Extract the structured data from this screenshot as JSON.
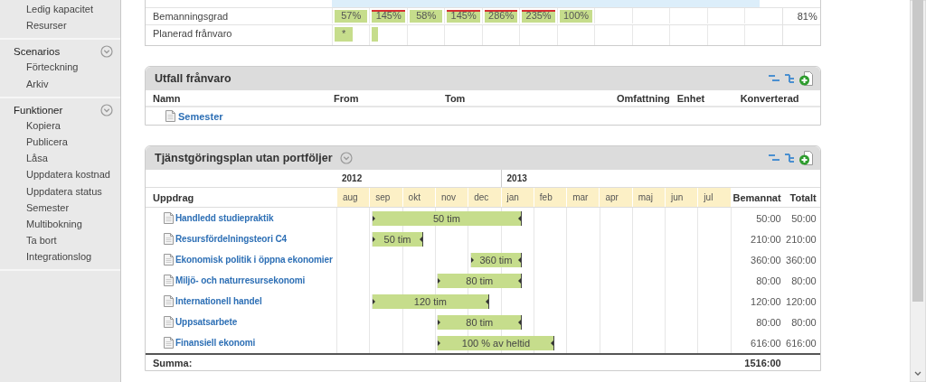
{
  "sidebar": {
    "groups": [
      {
        "items": [
          "Ledig kapacitet",
          "Resurser"
        ]
      },
      {
        "title": "Scenarios",
        "items": [
          "Förteckning",
          "Arkiv"
        ]
      },
      {
        "title": "Funktioner",
        "items": [
          "Kopiera",
          "Publicera",
          "Låsa",
          "Uppdatera kostnad",
          "Uppdatera status",
          "Semester",
          "Multibokning",
          "Ta bort",
          "Integrationslog"
        ]
      }
    ]
  },
  "staffing": {
    "rows": [
      {
        "label": "Bemanningsgrad",
        "kind": "percent",
        "total": "81%",
        "cells": [
          {
            "text": "57%",
            "over": false
          },
          {
            "text": "145%",
            "over": true
          },
          {
            "text": "58%",
            "over": false
          },
          {
            "text": "145%",
            "over": true
          },
          {
            "text": "286%",
            "over": true
          },
          {
            "text": "235%",
            "over": true
          },
          {
            "text": "100%",
            "over": false
          }
        ]
      },
      {
        "label": "Planerad frånvaro",
        "kind": "absence",
        "cells": [
          {
            "text": "*",
            "level": 0.5
          },
          {
            "level": 0.17
          }
        ]
      }
    ]
  },
  "absence": {
    "title": "Utfall frånvaro",
    "columns": [
      "Namn",
      "From",
      "Tom",
      "Omfattning",
      "Enhet",
      "Konverterad"
    ],
    "rows": [
      {
        "name": "Semester"
      }
    ]
  },
  "plan": {
    "title": "Tjänstgöringsplan utan portföljer",
    "years": [
      {
        "label": "2012",
        "months": [
          "aug",
          "sep",
          "okt",
          "nov",
          "dec"
        ]
      },
      {
        "label": "2013",
        "months": [
          "jan",
          "feb",
          "mar",
          "apr",
          "maj",
          "jun",
          "jul"
        ]
      }
    ],
    "first_column": "Uppdrag",
    "sum_columns": [
      "Bemannat",
      "Totalt"
    ],
    "rows": [
      {
        "name": "Handledd studiepraktik",
        "covered": [
          false,
          true,
          true,
          true,
          true,
          true,
          false,
          false,
          false,
          false,
          false,
          false
        ],
        "bar": "50 tim",
        "staffed": "50:00",
        "total": "50:00"
      },
      {
        "name": "Resursfördelningsteori C4",
        "covered": [
          false,
          true,
          true,
          false,
          false,
          false,
          false,
          false,
          false,
          false,
          false,
          false
        ],
        "bar": "50 tim",
        "staffed": "210:00",
        "total": "210:00"
      },
      {
        "name": "Ekonomisk politik i öppna ekonomier",
        "covered": [
          false,
          false,
          false,
          false,
          true,
          true,
          false,
          false,
          false,
          false,
          false,
          false
        ],
        "bar": "360 tim",
        "staffed": "360:00",
        "total": "360:00"
      },
      {
        "name": "Miljö- och naturresursekonomi",
        "covered": [
          false,
          false,
          false,
          true,
          true,
          true,
          false,
          false,
          false,
          false,
          false,
          false
        ],
        "bar": "80 tim",
        "staffed": "80:00",
        "total": "80:00"
      },
      {
        "name": "Internationell handel",
        "covered": [
          false,
          true,
          true,
          true,
          true,
          false,
          false,
          false,
          false,
          false,
          false,
          false
        ],
        "bar": "120 tim",
        "staffed": "120:00",
        "total": "120:00"
      },
      {
        "name": "Uppsatsarbete",
        "covered": [
          false,
          false,
          false,
          true,
          true,
          true,
          false,
          false,
          false,
          false,
          false,
          false
        ],
        "bar": "80 tim",
        "staffed": "80:00",
        "total": "80:00"
      },
      {
        "name": "Finansiell ekonomi",
        "covered": [
          false,
          false,
          false,
          true,
          true,
          true,
          true,
          false,
          false,
          false,
          false,
          false
        ],
        "bar": "100 % av heltid",
        "staffed": "616:00",
        "total": "616:00"
      }
    ],
    "sum_label": "Summa:",
    "sum_staffed": "1516:00"
  }
}
